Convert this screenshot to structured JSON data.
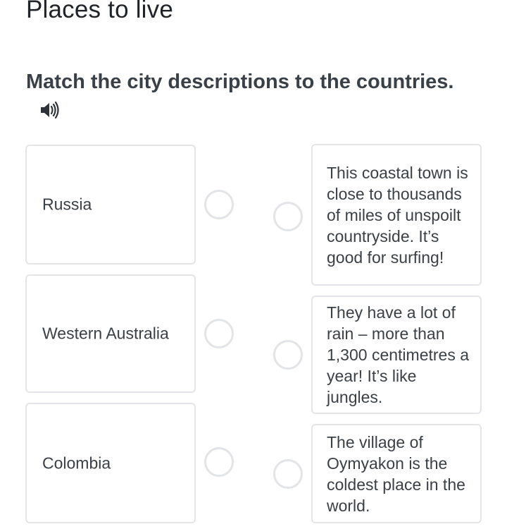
{
  "header": {
    "title": "Places to live"
  },
  "exercise": {
    "instruction": "Match the city descriptions to the countries.",
    "audio_icon": "speaker-icon"
  },
  "left_items": [
    {
      "label": "Russia"
    },
    {
      "label": "Western Australia"
    },
    {
      "label": "Colombia"
    }
  ],
  "right_items": [
    {
      "text": "This coastal town is close to thousands of miles of unspoilt countryside. It’s good for surfing!"
    },
    {
      "text": "They have a lot of rain – more than 1,300 centimetres a year! It’s like jungles."
    },
    {
      "text": "The village of Oymyakon is the coldest place in the world."
    }
  ],
  "colors": {
    "card_border": "#e3e5e8",
    "dot_border": "#e2e4e7",
    "text": "#3b4046"
  }
}
